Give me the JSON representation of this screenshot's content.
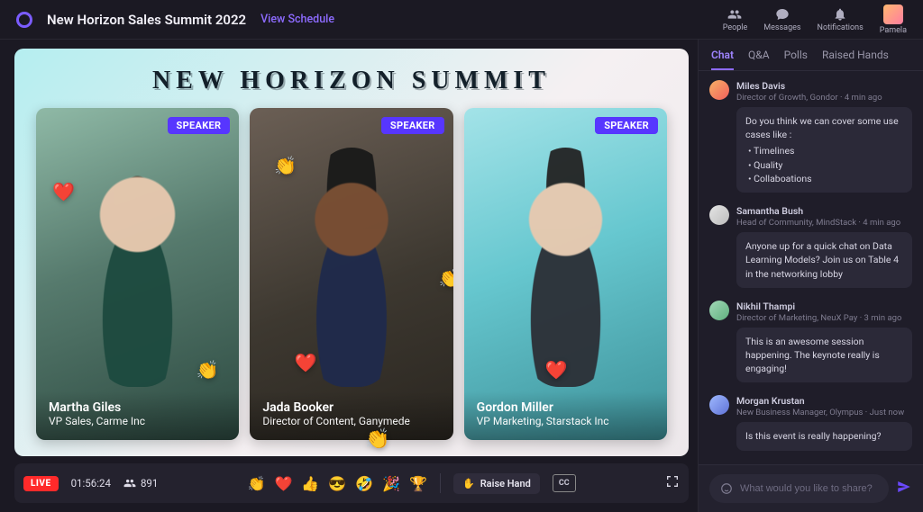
{
  "header": {
    "event_title": "New Horizon Sales Summit 2022",
    "view_schedule": "View Schedule",
    "nav": {
      "people": "People",
      "messages": "Messages",
      "notifications": "Notifications",
      "user": "Pamela"
    }
  },
  "stage": {
    "banner": "NEW HORIZON SUMMIT",
    "speaker_badge": "SPEAKER",
    "speakers": [
      {
        "name": "Martha Giles",
        "role": "VP Sales, Carme Inc"
      },
      {
        "name": "Jada Booker",
        "role": "Director of Content, Ganymede"
      },
      {
        "name": "Gordon Miller",
        "role": "VP Marketing, Starstack Inc"
      }
    ]
  },
  "controls": {
    "live": "LIVE",
    "timer": "01:56:24",
    "attendees": "891",
    "reactions": [
      "👏",
      "❤️",
      "👍",
      "😎",
      "🤣",
      "🎉",
      "🏆"
    ],
    "raise_hand_icon": "✋",
    "raise_hand": "Raise Hand",
    "cc": "CC"
  },
  "sidebar": {
    "tabs": [
      "Chat",
      "Q&A",
      "Polls",
      "Raised Hands"
    ],
    "active_tab": 0,
    "messages": [
      {
        "author": "Miles Davis",
        "subtitle": "Director of Growth, Gondor · 4 min ago",
        "text": "Do you think we can cover some use cases like :",
        "bullets": [
          "Timelines",
          "Quality",
          "Collaboations"
        ]
      },
      {
        "author": "Samantha Bush",
        "subtitle": "Head of Community, MindStack · 4 min ago",
        "text": "Anyone up for a quick chat on Data Learning Models? Join us on Table 4 in the networking lobby"
      },
      {
        "author": "Nikhil Thampi",
        "subtitle": "Director of Marketing, NeuX Pay · 3 min ago",
        "text": "This is an awesome session happening. The keynote really is engaging!"
      },
      {
        "author": "Morgan Krustan",
        "subtitle": "New Business Manager, Olympus · Just now",
        "text": "Is this event is really happening?"
      }
    ],
    "input_placeholder": "What would you like to share?"
  }
}
